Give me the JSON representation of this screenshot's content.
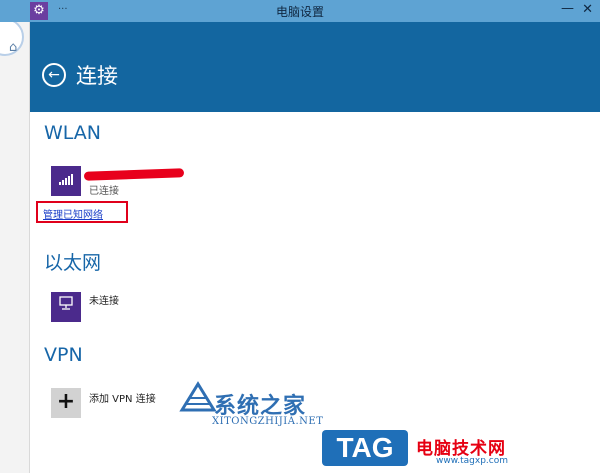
{
  "window": {
    "title": "电脑设置",
    "menu_glyph": "...",
    "app_icon": "gear-icon",
    "minimize_glyph": "—",
    "close_glyph": "✕"
  },
  "header": {
    "back_icon": "back-arrow-icon",
    "title": "连接",
    "background_color": "#1366a0"
  },
  "sections": {
    "wlan": {
      "title": "WLAN",
      "network_status": "已连接",
      "manage_link": "管理已知网络"
    },
    "ethernet": {
      "title": "以太网",
      "status": "未连接"
    },
    "vpn": {
      "title": "VPN",
      "add_label": "添加 VPN 连接"
    }
  },
  "watermarks": {
    "site_cn": "系统之家",
    "site_en": "XITONGZHIJIA.NET",
    "tag": "TAG",
    "tag_cn": "电脑技术网",
    "url": "www.tagxp.com"
  },
  "colors": {
    "accent": "#1366a0",
    "tile": "#4b2a8c",
    "highlight_box": "#e0001b"
  }
}
